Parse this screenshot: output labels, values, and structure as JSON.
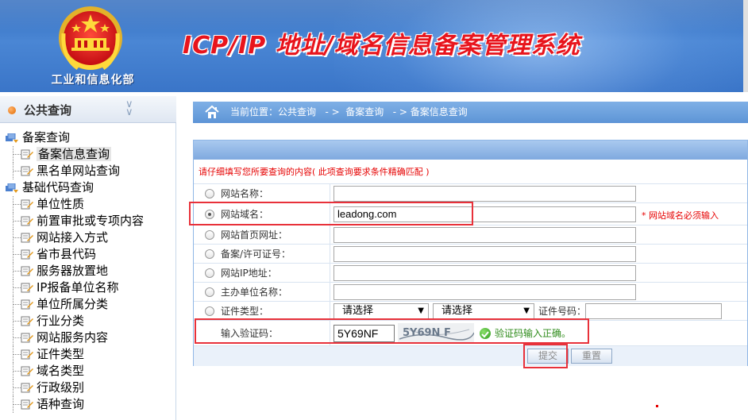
{
  "colors": {
    "header_blue": "#3a75c8",
    "title_red": "#e8141c",
    "notice_red": "#e60000",
    "ok_green": "#2e8b1a",
    "highlight_red": "#e8313a"
  },
  "header": {
    "ministry_name": "工业和信息化部",
    "system_title": "ICP/IP 地址/域名信息备案管理系统",
    "emblem_icon": "national-emblem-icon"
  },
  "sidebar": {
    "title": "公共查询",
    "collapse_icon": "double-chevron-down-icon",
    "groups": [
      {
        "label": "备案查询",
        "items": [
          "备案信息查询",
          "黑名单网站查询"
        ]
      },
      {
        "label": "基础代码查询",
        "items": [
          "单位性质",
          "前置审批或专项内容",
          "网站接入方式",
          "省市县代码",
          "服务器放置地",
          "IP报备单位名称",
          "单位所属分类",
          "行业分类",
          "网站服务内容",
          "证件类型",
          "域名类型",
          "行政级别",
          "语种查询"
        ]
      }
    ],
    "active_item": "备案信息查询"
  },
  "breadcrumb": {
    "text": "当前位置：公共查询   - >  备案查询   - > 备案信息查询"
  },
  "form": {
    "notice": "请仔细填写您所要查询的内容( 此项查询要求条件精确匹配 )",
    "rows": [
      {
        "label": "网站名称：",
        "value": "",
        "selected": false
      },
      {
        "label": "网站域名：",
        "value": "leadong.com",
        "selected": true,
        "required_note": "* 网站域名必须输入"
      },
      {
        "label": "网站首页网址：",
        "value": "",
        "selected": false
      },
      {
        "label": "备案/许可证号：",
        "value": "",
        "selected": false
      },
      {
        "label": "网站IP地址：",
        "value": "",
        "selected": false
      },
      {
        "label": "主办单位名称：",
        "value": "",
        "selected": false
      }
    ],
    "cert": {
      "label": "证件类型：",
      "select1": "请选择",
      "select2": "请选择",
      "number_label": "证件号码："
    },
    "captcha": {
      "label": "输入验证码：",
      "value": "5Y69NF",
      "image_text": "5Y69N F",
      "ok_text": "验证码输入正确。"
    },
    "buttons": {
      "submit": "提交",
      "reset": "重置"
    }
  }
}
